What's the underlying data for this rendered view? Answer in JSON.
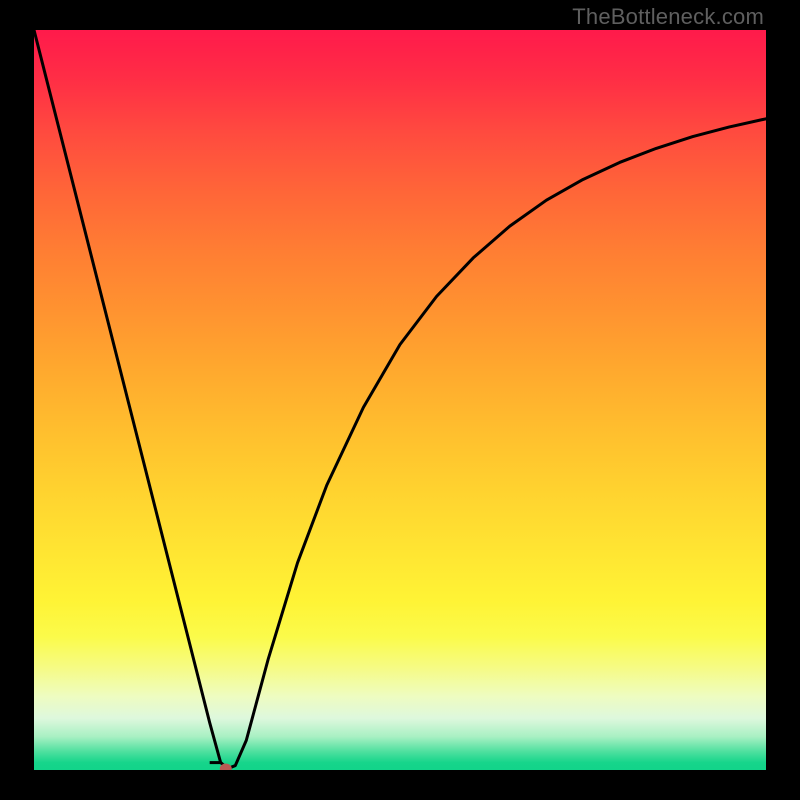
{
  "watermark": {
    "text": "TheBottleneck.com"
  },
  "chart_data": {
    "type": "line",
    "title": "",
    "xlabel": "",
    "ylabel": "",
    "xlim": [
      0,
      100
    ],
    "ylim": [
      0,
      100
    ],
    "series": [
      {
        "name": "bottleneck-curve",
        "x": [
          0,
          5,
          10,
          15,
          20,
          24,
          25.5,
          26.5,
          27.5,
          29,
          32,
          36,
          40,
          45,
          50,
          55,
          60,
          65,
          70,
          75,
          80,
          85,
          90,
          95,
          100
        ],
        "values": [
          100,
          80.5,
          61,
          41.5,
          22,
          6.4,
          1.0,
          0.2,
          0.6,
          4.0,
          15,
          28,
          38.5,
          49,
          57.5,
          64,
          69.2,
          73.5,
          77,
          79.8,
          82.1,
          84,
          85.6,
          86.9,
          88
        ]
      }
    ],
    "marker": {
      "x": 26.2,
      "y": 0.2,
      "color": "#b85a53",
      "size": 8
    },
    "notch": {
      "x_start": 24.0,
      "x_end": 25.5,
      "y": 1.0
    },
    "gradient_stops": [
      {
        "pct": 0,
        "color": "#ff1a4b"
      },
      {
        "pct": 50,
        "color": "#ffbe2e"
      },
      {
        "pct": 82,
        "color": "#fbfb4a"
      },
      {
        "pct": 100,
        "color": "#12d48a"
      }
    ]
  }
}
